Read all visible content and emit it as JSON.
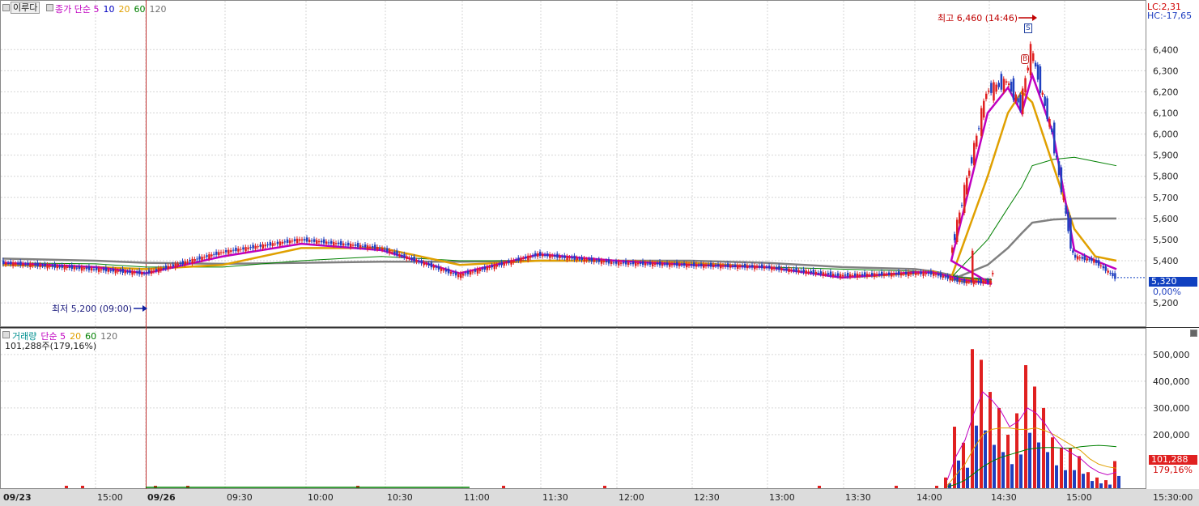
{
  "toolbar": {
    "legend_button": "이루다"
  },
  "price_legend": {
    "items": [
      {
        "text": "종가 단순 5",
        "color": "#c000c0"
      },
      {
        "text": "10",
        "color": "#0000c0"
      },
      {
        "text": "20",
        "color": "#e0a000"
      },
      {
        "text": "60",
        "color": "#008000"
      },
      {
        "text": "120",
        "color": "#707070"
      }
    ]
  },
  "volume_legend": {
    "items": [
      {
        "text": "거래량",
        "color": "#009090"
      },
      {
        "text": "단순 5",
        "color": "#c000c0"
      },
      {
        "text": "20",
        "color": "#e0a000"
      },
      {
        "text": "60",
        "color": "#008000"
      },
      {
        "text": "120",
        "color": "#707070"
      }
    ],
    "value_text": "101,288주(179,16%)"
  },
  "annotations": {
    "high": "최고 6,460 (14:46)",
    "low": "최저 5,200 (09:00)",
    "sell_marker": "S",
    "buy_marker": "B"
  },
  "right_panel": {
    "lc": "LC:2,31",
    "hc": "HC:-17,65",
    "price_tag": "5,320",
    "pct_tag": "0,00%",
    "vol_tag": "101,288",
    "vol_pct_tag": "179,16%"
  },
  "colors": {
    "up": "#e02020",
    "down": "#2040c0",
    "ma5": "#c000c0",
    "ma10": "#0000c0",
    "ma20": "#e0a000",
    "ma60": "#008000",
    "ma120": "#808080"
  },
  "chart_data": [
    {
      "type": "candlestick",
      "title": "",
      "y_ticks": [
        6400,
        6300,
        6200,
        6100,
        6000,
        5900,
        5800,
        5700,
        5600,
        5500,
        5400,
        5200
      ],
      "y_tick_labels": [
        "6,400",
        "6,300",
        "6,200",
        "6,100",
        "6,000",
        "5,900",
        "5,800",
        "5,700",
        "5,600",
        "5,500",
        "5,400",
        "5,200"
      ],
      "ylim": [
        5120,
        6520
      ],
      "x_tick_labels": [
        "09/23",
        "15:00",
        "09/26",
        "09:30",
        "10:00",
        "10:30",
        "11:00",
        "11:30",
        "12:00",
        "12:30",
        "13:00",
        "13:30",
        "14:00",
        "14:30",
        "15:00",
        "15:30:00"
      ],
      "series": [
        {
          "name": "종가",
          "x": [
            "09/23 14:30",
            "09/23 15:00",
            "09/26 09:00",
            "09:15",
            "09:30",
            "09:45",
            "10:00",
            "10:15",
            "10:30",
            "11:00",
            "11:30",
            "12:00",
            "12:30",
            "13:00",
            "13:30",
            "14:00",
            "14:05",
            "14:15",
            "14:25",
            "14:35",
            "14:46",
            "14:55",
            "15:05",
            "15:15",
            "15:20"
          ],
          "values": [
            5390,
            5360,
            5340,
            5440,
            5500,
            5460,
            5330,
            5430,
            5390,
            5380,
            5370,
            5330,
            5340,
            5340,
            5300,
            5300,
            5420,
            6200,
            6250,
            6130,
            6400,
            6000,
            5420,
            5400,
            5320
          ]
        },
        {
          "name": "5",
          "values": [
            5390,
            5370,
            5340,
            5420,
            5480,
            5450,
            5340,
            5430,
            5400,
            5380,
            5370,
            5320,
            5345,
            5345,
            5310,
            5290,
            5400,
            6100,
            6220,
            6100,
            6280,
            6000,
            5450,
            5400,
            5360
          ]
        },
        {
          "name": "20",
          "values": [
            5380,
            5370,
            5360,
            5380,
            5460,
            5460,
            5380,
            5400,
            5400,
            5390,
            5370,
            5320,
            5340,
            5350,
            5300,
            5300,
            5320,
            5800,
            6100,
            6200,
            6150,
            5850,
            5550,
            5420,
            5400
          ]
        },
        {
          "name": "60",
          "values": [
            5390,
            5385,
            5370,
            5370,
            5400,
            5420,
            5400,
            5400,
            5400,
            5390,
            5370,
            5360,
            5350,
            5340,
            5320,
            5310,
            5320,
            5500,
            5650,
            5750,
            5850,
            5880,
            5890,
            5870,
            5850
          ]
        },
        {
          "name": "120",
          "values": [
            5410,
            5400,
            5390,
            5385,
            5390,
            5395,
            5395,
            5400,
            5400,
            5400,
            5390,
            5370,
            5360,
            5350,
            5320,
            5310,
            5310,
            5380,
            5460,
            5530,
            5580,
            5595,
            5600,
            5600,
            5600
          ]
        }
      ]
    },
    {
      "type": "bar",
      "title": "거래량",
      "y_ticks": [
        500000,
        400000,
        300000,
        200000
      ],
      "y_tick_labels": [
        "500,000",
        "400,000",
        "300,000",
        "200,000"
      ],
      "ylim": [
        0,
        560000
      ],
      "series": [
        {
          "name": "거래량",
          "x": [
            "14:04",
            "14:08",
            "14:12",
            "14:16",
            "14:20",
            "14:24",
            "14:28",
            "14:32",
            "14:36",
            "14:40",
            "14:44",
            "14:48",
            "14:52",
            "14:56",
            "15:00",
            "15:04",
            "15:08",
            "15:12",
            "15:16",
            "15:20"
          ],
          "values": [
            40000,
            230000,
            170000,
            520000,
            480000,
            360000,
            300000,
            200000,
            280000,
            460000,
            380000,
            300000,
            190000,
            150000,
            150000,
            120000,
            60000,
            40000,
            30000,
            101288
          ]
        },
        {
          "name": "5",
          "values": [
            30000,
            120000,
            180000,
            280000,
            360000,
            330000,
            290000,
            230000,
            250000,
            300000,
            280000,
            240000,
            190000,
            150000,
            130000,
            110000,
            80000,
            60000,
            50000,
            60000
          ]
        },
        {
          "name": "20",
          "values": [
            10000,
            50000,
            90000,
            150000,
            200000,
            220000,
            225000,
            225000,
            220000,
            220000,
            225000,
            215000,
            200000,
            180000,
            160000,
            140000,
            110000,
            90000,
            80000,
            75000
          ]
        },
        {
          "name": "60",
          "values": [
            5000,
            15000,
            30000,
            55000,
            80000,
            100000,
            115000,
            125000,
            135000,
            145000,
            150000,
            152000,
            152000,
            150000,
            150000,
            155000,
            158000,
            160000,
            158000,
            155000
          ]
        }
      ]
    }
  ]
}
